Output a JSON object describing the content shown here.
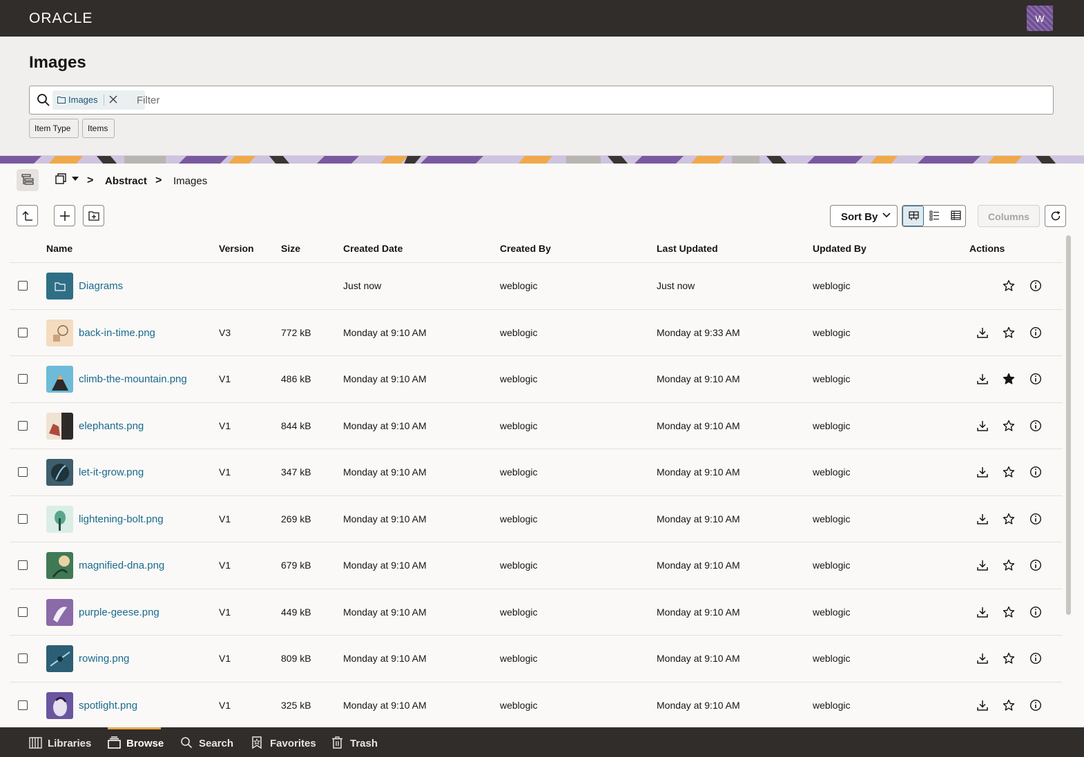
{
  "topbar": {
    "logo": "ORACLE",
    "avatar_initial": "W"
  },
  "header": {
    "title": "Images",
    "search": {
      "chip_label": "Images",
      "placeholder": "Filter",
      "value": ""
    },
    "tags": [
      "Item Type",
      "Items"
    ]
  },
  "breadcrumb": {
    "items": [
      "Abstract",
      "Images"
    ],
    "separator": ">"
  },
  "toolbar": {
    "sort_label": "Sort By",
    "columns_label": "Columns"
  },
  "table": {
    "columns": [
      "Name",
      "Version",
      "Size",
      "Created Date",
      "Created By",
      "Last Updated",
      "Updated By",
      "Actions"
    ],
    "rows": [
      {
        "name": "Diagrams",
        "version": "",
        "size": "",
        "created": "Just now",
        "created_by": "weblogic",
        "updated": "Just now",
        "updated_by": "weblogic",
        "favorite": false,
        "folder": true
      },
      {
        "name": "back-in-time.png",
        "version": "V3",
        "size": "772 kB",
        "created": "Monday at 9:10 AM",
        "created_by": "weblogic",
        "updated": "Monday at 9:33 AM",
        "updated_by": "weblogic",
        "favorite": false
      },
      {
        "name": "climb-the-mountain.png",
        "version": "V1",
        "size": "486 kB",
        "created": "Monday at 9:10 AM",
        "created_by": "weblogic",
        "updated": "Monday at 9:10 AM",
        "updated_by": "weblogic",
        "favorite": true
      },
      {
        "name": "elephants.png",
        "version": "V1",
        "size": "844 kB",
        "created": "Monday at 9:10 AM",
        "created_by": "weblogic",
        "updated": "Monday at 9:10 AM",
        "updated_by": "weblogic",
        "favorite": false
      },
      {
        "name": "let-it-grow.png",
        "version": "V1",
        "size": "347 kB",
        "created": "Monday at 9:10 AM",
        "created_by": "weblogic",
        "updated": "Monday at 9:10 AM",
        "updated_by": "weblogic",
        "favorite": false
      },
      {
        "name": "lightening-bolt.png",
        "version": "V1",
        "size": "269 kB",
        "created": "Monday at 9:10 AM",
        "created_by": "weblogic",
        "updated": "Monday at 9:10 AM",
        "updated_by": "weblogic",
        "favorite": false
      },
      {
        "name": "magnified-dna.png",
        "version": "V1",
        "size": "679 kB",
        "created": "Monday at 9:10 AM",
        "created_by": "weblogic",
        "updated": "Monday at 9:10 AM",
        "updated_by": "weblogic",
        "favorite": false
      },
      {
        "name": "purple-geese.png",
        "version": "V1",
        "size": "449 kB",
        "created": "Monday at 9:10 AM",
        "created_by": "weblogic",
        "updated": "Monday at 9:10 AM",
        "updated_by": "weblogic",
        "favorite": false
      },
      {
        "name": "rowing.png",
        "version": "V1",
        "size": "809 kB",
        "created": "Monday at 9:10 AM",
        "created_by": "weblogic",
        "updated": "Monday at 9:10 AM",
        "updated_by": "weblogic",
        "favorite": false
      },
      {
        "name": "spotlight.png",
        "version": "V1",
        "size": "325 kB",
        "created": "Monday at 9:10 AM",
        "created_by": "weblogic",
        "updated": "Monday at 9:10 AM",
        "updated_by": "weblogic",
        "favorite": false
      }
    ]
  },
  "bottomnav": {
    "items": [
      {
        "label": "Libraries",
        "icon": "libraries-icon"
      },
      {
        "label": "Browse",
        "icon": "browse-icon",
        "active": true
      },
      {
        "label": "Search",
        "icon": "search-icon"
      },
      {
        "label": "Favorites",
        "icon": "favorites-icon"
      },
      {
        "label": "Trash",
        "icon": "trash-icon"
      }
    ]
  },
  "colors": {
    "accent": "#1a6a8e",
    "topbar": "#312d2a",
    "active_tab": "#e9a84c"
  }
}
